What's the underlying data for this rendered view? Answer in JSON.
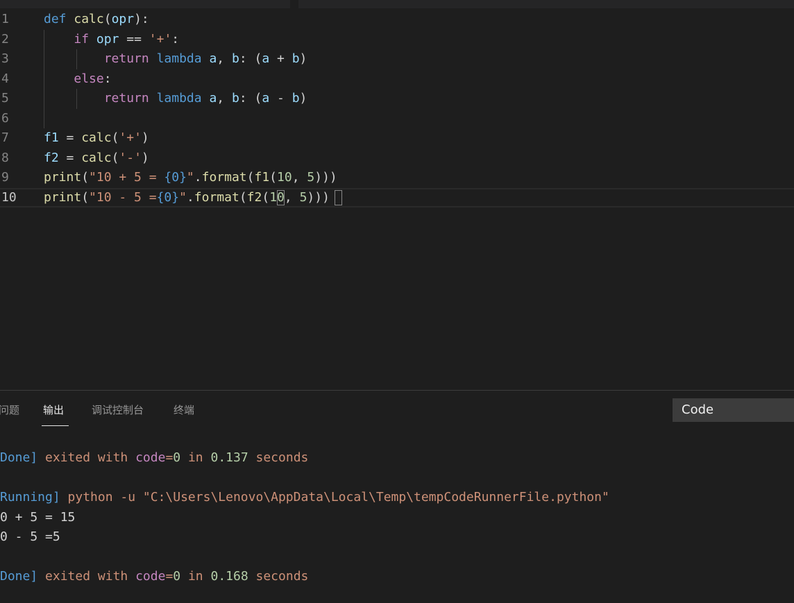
{
  "editor": {
    "lines": [
      {
        "number": "1",
        "tokens": [
          [
            "kw",
            "def"
          ],
          [
            "op",
            " "
          ],
          [
            "fn",
            "calc"
          ],
          [
            "op",
            "("
          ],
          [
            "var",
            "opr"
          ],
          [
            "op",
            "):"
          ]
        ]
      },
      {
        "number": "2",
        "tokens": [
          [
            "op",
            "    "
          ],
          [
            "ctl",
            "if"
          ],
          [
            "op",
            " "
          ],
          [
            "var",
            "opr"
          ],
          [
            "op",
            " == "
          ],
          [
            "str",
            "'+'"
          ],
          [
            "op",
            ":"
          ]
        ]
      },
      {
        "number": "3",
        "tokens": [
          [
            "op",
            "        "
          ],
          [
            "ctl",
            "return"
          ],
          [
            "op",
            " "
          ],
          [
            "kw",
            "lambda"
          ],
          [
            "op",
            " "
          ],
          [
            "var",
            "a"
          ],
          [
            "op",
            ", "
          ],
          [
            "var",
            "b"
          ],
          [
            "op",
            ": ("
          ],
          [
            "var",
            "a"
          ],
          [
            "op",
            " + "
          ],
          [
            "var",
            "b"
          ],
          [
            "op",
            ")"
          ]
        ]
      },
      {
        "number": "4",
        "tokens": [
          [
            "op",
            "    "
          ],
          [
            "ctl",
            "else"
          ],
          [
            "op",
            ":"
          ]
        ]
      },
      {
        "number": "5",
        "tokens": [
          [
            "op",
            "        "
          ],
          [
            "ctl",
            "return"
          ],
          [
            "op",
            " "
          ],
          [
            "kw",
            "lambda"
          ],
          [
            "op",
            " "
          ],
          [
            "var",
            "a"
          ],
          [
            "op",
            ", "
          ],
          [
            "var",
            "b"
          ],
          [
            "op",
            ": ("
          ],
          [
            "var",
            "a"
          ],
          [
            "op",
            " - "
          ],
          [
            "var",
            "b"
          ],
          [
            "op",
            ")"
          ]
        ]
      },
      {
        "number": "6",
        "tokens": []
      },
      {
        "number": "7",
        "tokens": [
          [
            "var",
            "f1"
          ],
          [
            "op",
            " = "
          ],
          [
            "fn",
            "calc"
          ],
          [
            "op",
            "("
          ],
          [
            "str",
            "'+'"
          ],
          [
            "op",
            ")"
          ]
        ]
      },
      {
        "number": "8",
        "tokens": [
          [
            "var",
            "f2"
          ],
          [
            "op",
            " = "
          ],
          [
            "fn",
            "calc"
          ],
          [
            "op",
            "("
          ],
          [
            "str",
            "'-'"
          ],
          [
            "op",
            ")"
          ]
        ]
      },
      {
        "number": "9",
        "tokens": [
          [
            "fn",
            "print"
          ],
          [
            "op",
            "("
          ],
          [
            "str",
            "\"10 + 5 = "
          ],
          [
            "kw",
            "{0}"
          ],
          [
            "str",
            "\""
          ],
          [
            "op",
            "."
          ],
          [
            "fn",
            "format"
          ],
          [
            "op",
            "("
          ],
          [
            "fn",
            "f1"
          ],
          [
            "op",
            "("
          ],
          [
            "num",
            "10"
          ],
          [
            "op",
            ", "
          ],
          [
            "num",
            "5"
          ],
          [
            "op",
            ")))"
          ]
        ]
      },
      {
        "number": "10",
        "tokens": [
          [
            "fn",
            "print"
          ],
          [
            "op",
            "("
          ],
          [
            "str",
            "\"10 - 5 ="
          ],
          [
            "kw",
            "{0}"
          ],
          [
            "str",
            "\""
          ],
          [
            "op",
            "."
          ],
          [
            "fn",
            "format"
          ],
          [
            "op",
            "("
          ],
          [
            "fn",
            "f2"
          ],
          [
            "op",
            "("
          ],
          [
            "num",
            "10"
          ],
          [
            "op",
            ", "
          ],
          [
            "num",
            "5"
          ],
          [
            "op",
            ")))"
          ]
        ]
      }
    ],
    "active_line": "10"
  },
  "panel": {
    "tabs": [
      "问题",
      "输出",
      "调试控制台",
      "终端"
    ],
    "active_tab": "输出",
    "output_channel": "Code",
    "output_lines": [
      [
        [
          "o-blue",
          "Done]"
        ],
        [
          "o-orange",
          " exited "
        ],
        [
          "o-orange",
          "with "
        ],
        [
          "o-purple",
          "code"
        ],
        [
          "o-orange",
          "="
        ],
        [
          "o-num",
          "0"
        ],
        [
          "o-orange",
          " in "
        ],
        [
          "o-num",
          "0.137"
        ],
        [
          "o-orange",
          " seconds"
        ]
      ],
      [],
      [
        [
          "o-blue",
          "Running]"
        ],
        [
          "o-orange",
          " python -u \"C:\\Users\\Lenovo\\AppData\\Local\\Temp\\tempCodeRunnerFile.python\""
        ]
      ],
      [
        [
          "op",
          "0 + 5 = 15"
        ]
      ],
      [
        [
          "op",
          "0 - 5 =5"
        ]
      ],
      [],
      [
        [
          "o-blue",
          "Done]"
        ],
        [
          "o-orange",
          " exited "
        ],
        [
          "o-orange",
          "with "
        ],
        [
          "o-purple",
          "code"
        ],
        [
          "o-orange",
          "="
        ],
        [
          "o-num",
          "0"
        ],
        [
          "o-orange",
          " in "
        ],
        [
          "o-num",
          "0.168"
        ],
        [
          "o-orange",
          " seconds"
        ]
      ]
    ]
  },
  "colors": {
    "background": "#1e1e1e",
    "keyword": "#569cd6",
    "control": "#c586c0",
    "function": "#dcdcaa",
    "variable": "#9cdcfe",
    "string": "#ce9178",
    "number": "#b5cea8"
  }
}
